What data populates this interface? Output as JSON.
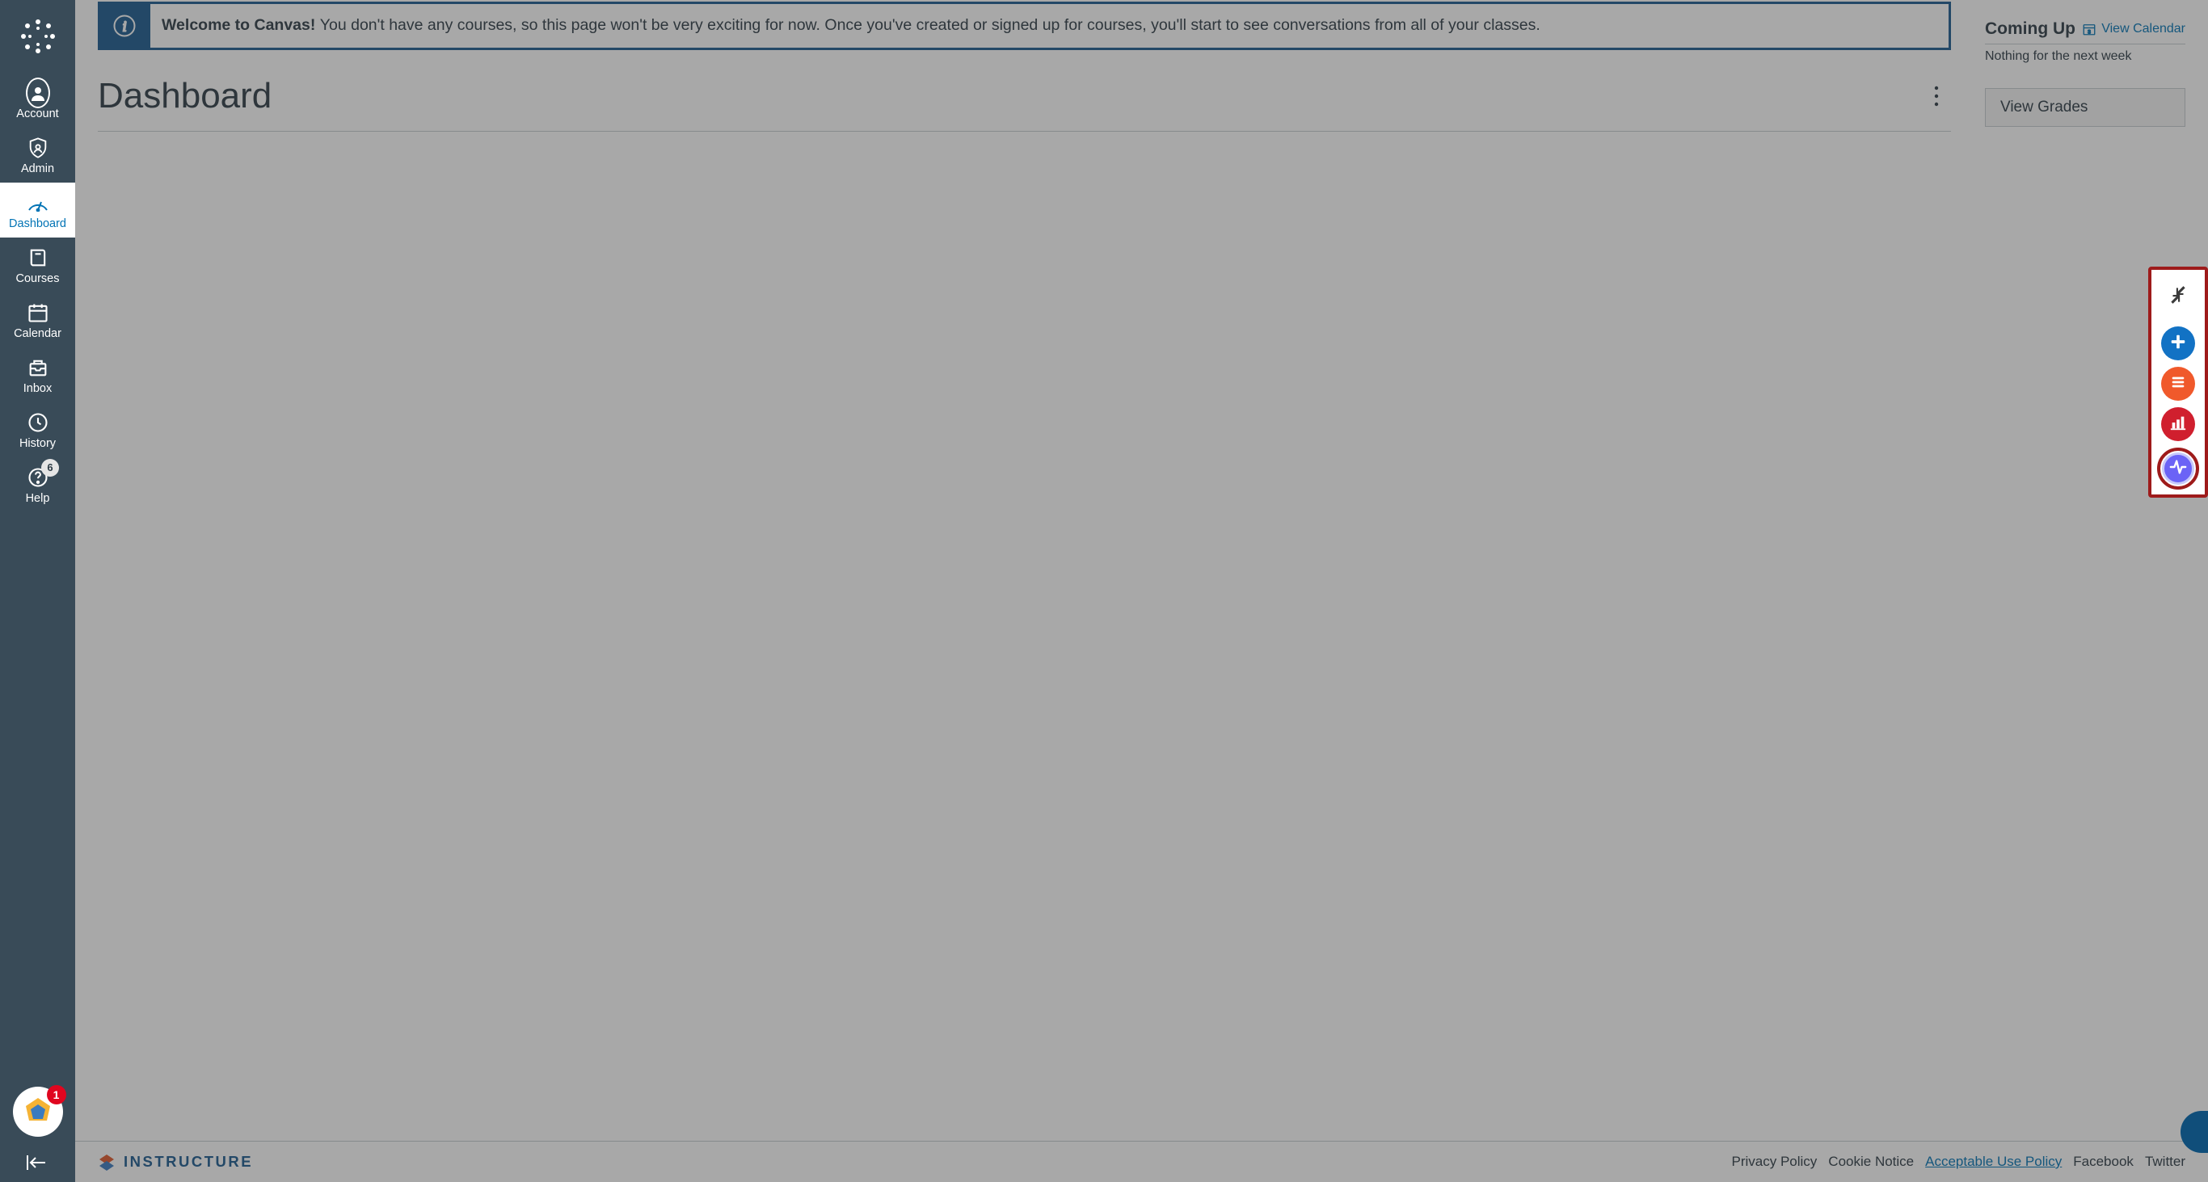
{
  "sidebar": {
    "items": [
      {
        "key": "account",
        "label": "Account"
      },
      {
        "key": "admin",
        "label": "Admin"
      },
      {
        "key": "dashboard",
        "label": "Dashboard"
      },
      {
        "key": "courses",
        "label": "Courses"
      },
      {
        "key": "calendar",
        "label": "Calendar"
      },
      {
        "key": "inbox",
        "label": "Inbox"
      },
      {
        "key": "history",
        "label": "History"
      },
      {
        "key": "help",
        "label": "Help",
        "badge": "6"
      }
    ],
    "active_index": 2,
    "panda_badge": "1"
  },
  "banner": {
    "title": "Welcome to Canvas!",
    "body": "You don't have any courses, so this page won't be very exciting for now. Once you've created or signed up for courses, you'll start to see conversations from all of your classes."
  },
  "page": {
    "title": "Dashboard"
  },
  "side_panel": {
    "coming_up_title": "Coming Up",
    "view_calendar_label": "View Calendar",
    "empty_text": "Nothing for the next week",
    "view_grades_label": "View Grades"
  },
  "footer": {
    "brand": "INSTRUCTURE",
    "links": [
      {
        "label": "Privacy Policy",
        "emph": false
      },
      {
        "label": "Cookie Notice",
        "emph": false
      },
      {
        "label": "Acceptable Use Policy",
        "emph": true
      },
      {
        "label": "Facebook",
        "emph": false
      },
      {
        "label": "Twitter",
        "emph": false
      }
    ]
  },
  "floating_toolbar": {
    "items": [
      {
        "key": "collapse",
        "name": "collapse-icon"
      },
      {
        "key": "add",
        "name": "plus-icon"
      },
      {
        "key": "list",
        "name": "list-icon"
      },
      {
        "key": "chart",
        "name": "bar-chart-icon"
      },
      {
        "key": "activity",
        "name": "activity-icon"
      }
    ]
  }
}
